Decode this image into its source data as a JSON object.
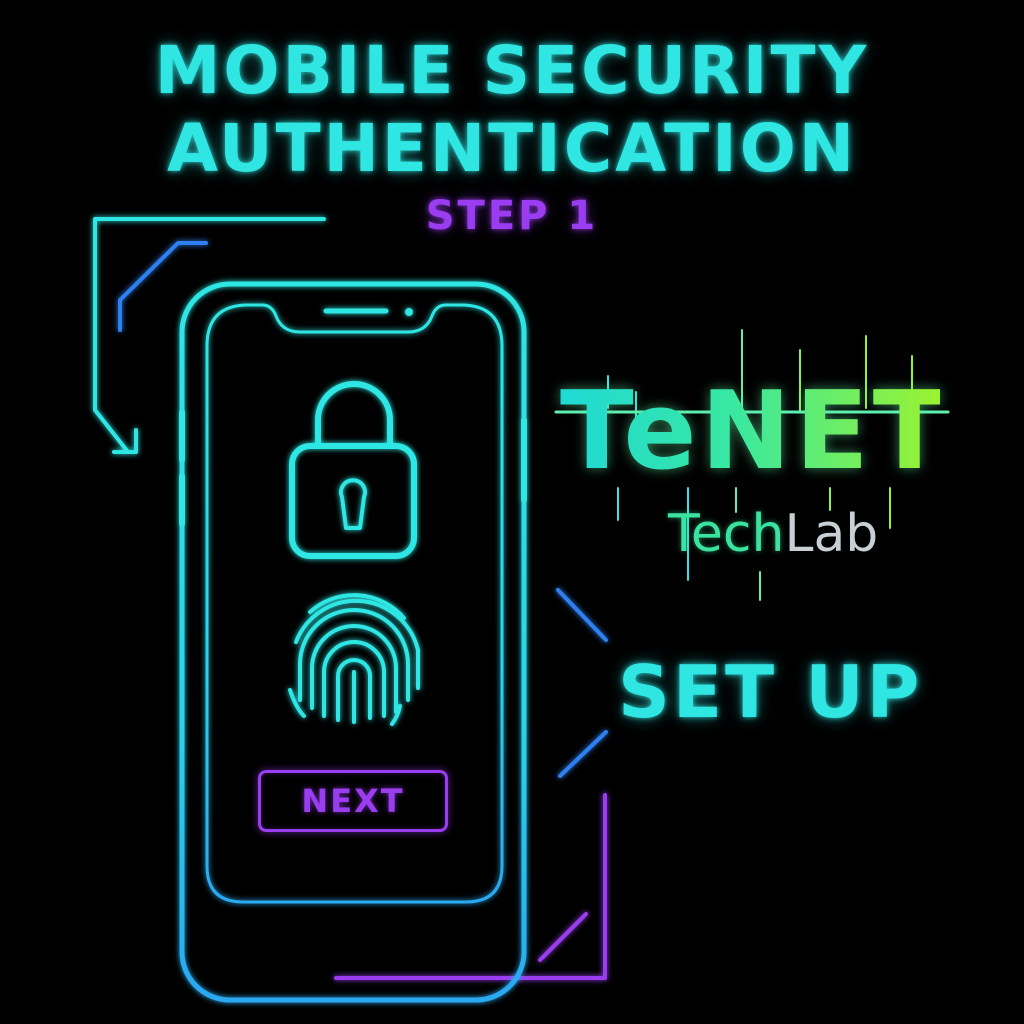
{
  "header": {
    "title_line_1": "MOBILE SECURITY",
    "title_line_2": "AUTHENTICATION",
    "step": "STEP 1"
  },
  "phone": {
    "next_label": "NEXT",
    "icons": [
      "lock-icon",
      "fingerprint-icon"
    ]
  },
  "logo": {
    "main": "TeNET",
    "sub_tech": "Tech",
    "sub_lab": "Lab"
  },
  "callout": {
    "label": "SET UP"
  },
  "colors": {
    "background": "#000000",
    "cyan": "#2fe6e3",
    "purple": "#9a3df0",
    "blue": "#2f7ff0",
    "green": "#9cf22f"
  }
}
